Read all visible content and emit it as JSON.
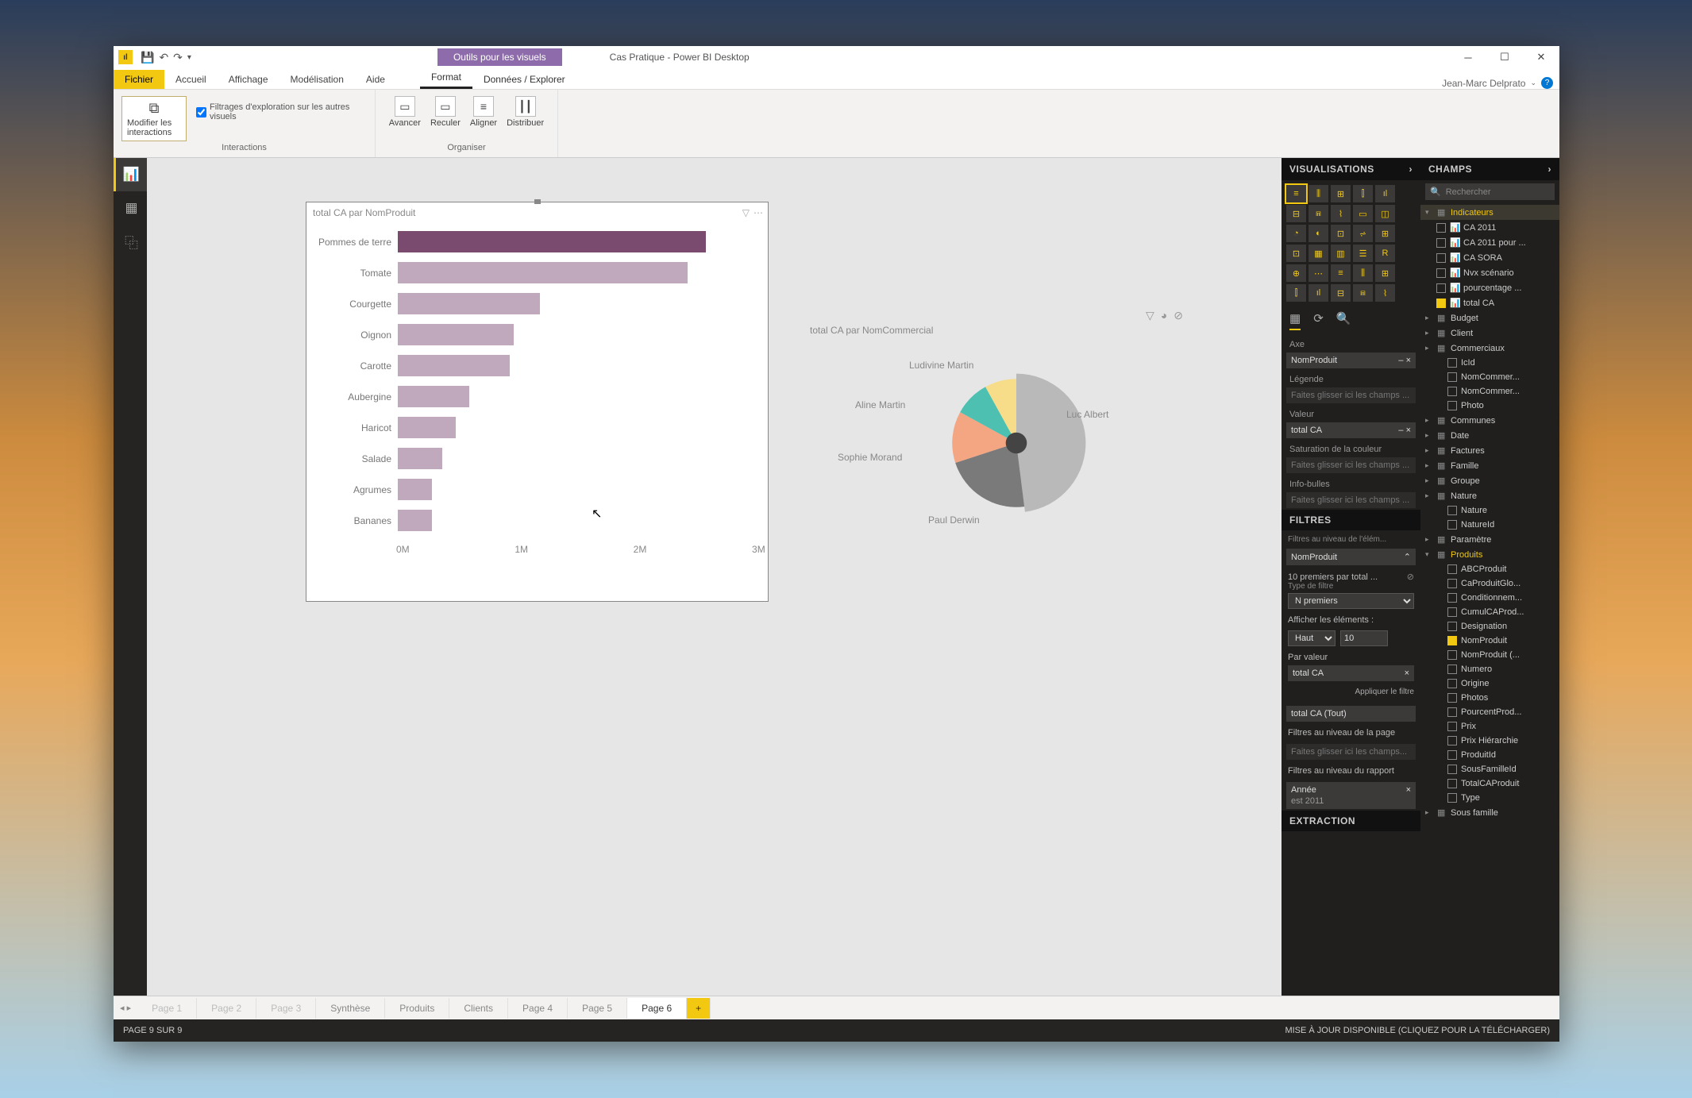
{
  "window": {
    "contextual_tab": "Outils pour les visuels",
    "title": "Cas Pratique - Power BI Desktop",
    "user": "Jean-Marc Delprato"
  },
  "tabs": {
    "file": "Fichier",
    "items": [
      "Accueil",
      "Affichage",
      "Modélisation",
      "Aide"
    ],
    "context": [
      "Format",
      "Données / Explorer"
    ]
  },
  "ribbon": {
    "edit_interactions": "Modifier les interactions",
    "drill_filters": "Filtrages d'exploration sur les autres visuels",
    "group_interactions": "Interactions",
    "forward": "Avancer",
    "backward": "Reculer",
    "align": "Aligner",
    "distribute": "Distribuer",
    "group_organize": "Organiser"
  },
  "bar_visual": {
    "title": "total CA par NomProduit",
    "axis_ticks": [
      "0M",
      "1M",
      "2M",
      "3M"
    ]
  },
  "pie_visual": {
    "title": "total CA par NomCommercial"
  },
  "chart_data": [
    {
      "type": "bar",
      "title": "total CA par NomProduit",
      "xlabel": "",
      "ylabel": "",
      "xlim": [
        0,
        3000000
      ],
      "categories": [
        "Pommes de terre",
        "Tomate",
        "Courgette",
        "Oignon",
        "Carotte",
        "Aubergine",
        "Haricot",
        "Salade",
        "Agrumes",
        "Bananes"
      ],
      "values": [
        2550000,
        2400000,
        1180000,
        960000,
        930000,
        590000,
        480000,
        370000,
        280000,
        280000
      ],
      "highlight_index": 0
    },
    {
      "type": "pie",
      "title": "total CA par NomCommercial",
      "series": [
        {
          "name": "Luc Albert",
          "value": 48,
          "color": "#b9b9b9"
        },
        {
          "name": "Paul Derwin",
          "value": 22,
          "color": "#7a7a7a"
        },
        {
          "name": "Sophie Morand",
          "value": 13,
          "color": "#f4a582"
        },
        {
          "name": "Aline Martin",
          "value": 9,
          "color": "#4ec0b2"
        },
        {
          "name": "Ludivine Martin",
          "value": 8,
          "color": "#f7dc8a"
        }
      ],
      "highlight_index": 0
    }
  ],
  "viz_pane": {
    "header": "VISUALISATIONS",
    "tab_fields": "Champs",
    "axis": "Axe",
    "axis_value": "NomProduit",
    "legend": "Légende",
    "placeholder": "Faites glisser ici les champs ...",
    "value": "Valeur",
    "value_field": "total CA",
    "saturation": "Saturation de la couleur",
    "tooltips": "Info-bulles",
    "filters_header": "FILTRES",
    "filters_level": "Filtres au niveau de l'élém...",
    "filter_field": "NomProduit",
    "filter_desc": "10 premiers par total ...",
    "filter_type_label": "Type de filtre",
    "filter_type": "N premiers",
    "show_items": "Afficher les éléments :",
    "show_dir": "Haut",
    "show_n": "10",
    "by_value": "Par valeur",
    "by_value_field": "total CA",
    "apply": "Appliquer le filtre",
    "filter2": "total CA  (Tout)",
    "page_filters": "Filtres au niveau de la page",
    "page_placeholder": "Faites glisser ici les champs...",
    "report_filters": "Filtres au niveau du rapport",
    "year_label": "Année",
    "year_value": "est 2011",
    "extraction": "EXTRACTION"
  },
  "fields_pane": {
    "header": "CHAMPS",
    "search": "Rechercher",
    "groups": {
      "indicateurs": {
        "label": "Indicateurs",
        "items": [
          "CA 2011",
          "CA 2011 pour ...",
          "CA SORA",
          "Nvx scénario",
          "pourcentage ...",
          "total CA"
        ],
        "checked": [
          5
        ]
      },
      "tables": [
        "Budget",
        "Client",
        "Commerciaux"
      ],
      "commerciaux_items": [
        "IcId",
        "NomCommer...",
        "NomCommer...",
        "Photo"
      ],
      "tables2": [
        "Communes",
        "Date",
        "Factures",
        "Famille",
        "Groupe",
        "Nature"
      ],
      "nature_items": [
        "Nature",
        "NatureId"
      ],
      "tables3": [
        "Paramètre",
        "Produits"
      ],
      "produits_items": [
        "ABCProduit",
        "CaProduitGlo...",
        "Conditionnem...",
        "CumulCAProd...",
        "Designation",
        "NomProduit",
        "NomProduit (...",
        "Numero",
        "Origine",
        "Photos",
        "PourcentProd...",
        "Prix",
        "Prix Hiérarchie",
        "ProduitId",
        "SousFamilleId",
        "TotalCAProduit",
        "Type"
      ],
      "produits_checked": [
        5
      ],
      "sous_famille": "Sous famille"
    }
  },
  "pages": {
    "dim": [
      "Page 1",
      "Page 2",
      "Page 3"
    ],
    "normal": [
      "Synthèse",
      "Produits",
      "Clients",
      "Page 4",
      "Page 5"
    ],
    "active": "Page 6"
  },
  "statusbar": {
    "left": "PAGE 9 SUR 9",
    "right": "MISE À JOUR DISPONIBLE (CLIQUEZ POUR LA TÉLÉCHARGER)"
  }
}
